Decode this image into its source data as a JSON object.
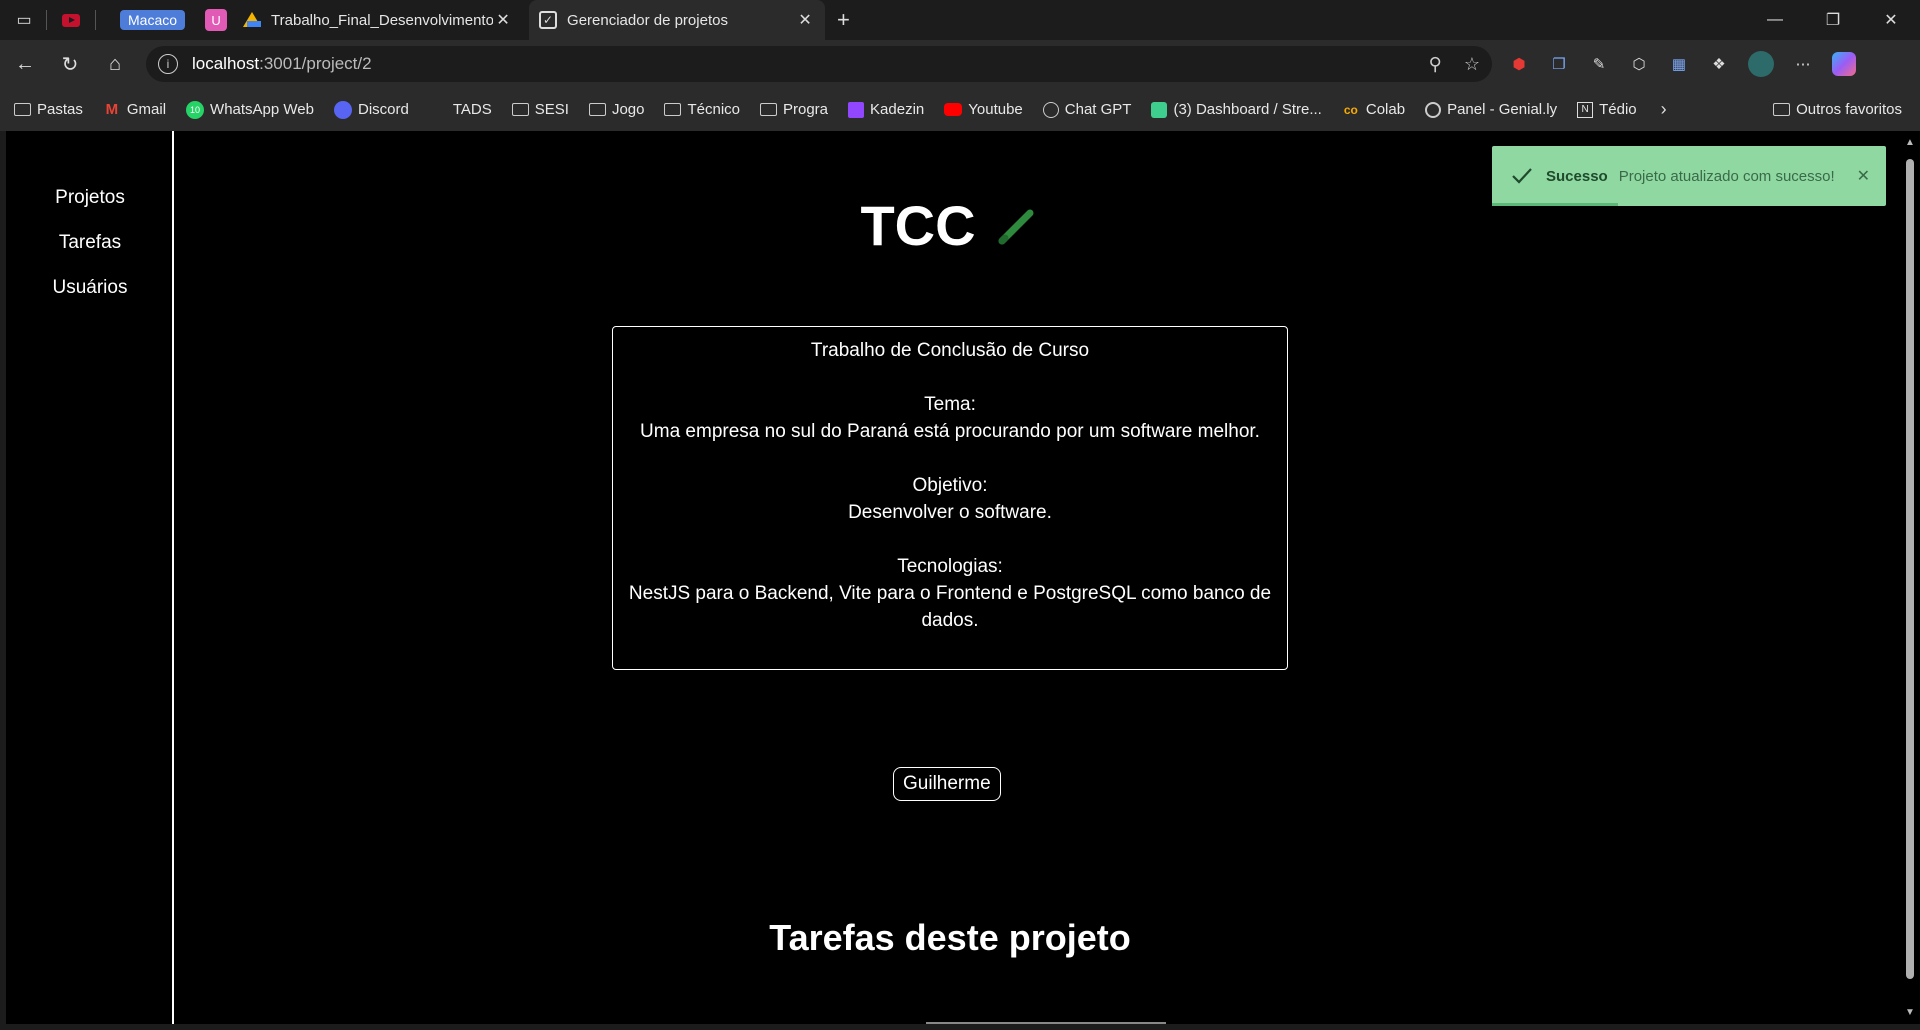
{
  "browser": {
    "group_label": "Macaco",
    "pinned_u": "U",
    "tabs": [
      {
        "title": "Trabalho_Final_Desenvolvimento_"
      },
      {
        "title": "Gerenciador de projetos"
      }
    ],
    "url_host": "localhost",
    "url_path": ":3001/project/2"
  },
  "bookmarks": {
    "items": [
      {
        "label": "Pastas",
        "icon": "folder-icon"
      },
      {
        "label": "Gmail",
        "icon": "gmail-icon"
      },
      {
        "label": "WhatsApp Web",
        "icon": "whatsapp-icon",
        "badge": "10"
      },
      {
        "label": "Discord",
        "icon": "discord-icon"
      },
      {
        "label": "TADS",
        "icon": "none"
      },
      {
        "label": "SESI",
        "icon": "folder-icon"
      },
      {
        "label": "Jogo",
        "icon": "folder-icon"
      },
      {
        "label": "Técnico",
        "icon": "folder-icon"
      },
      {
        "label": "Progra",
        "icon": "folder-icon"
      },
      {
        "label": "Kadezin",
        "icon": "twitch-icon"
      },
      {
        "label": "Youtube",
        "icon": "youtube-icon"
      },
      {
        "label": "Chat GPT",
        "icon": "chatgpt-icon"
      },
      {
        "label": "(3) Dashboard / Stre...",
        "icon": "dashboard-icon"
      },
      {
        "label": "Colab",
        "icon": "colab-icon"
      },
      {
        "label": "Panel - Genial.ly",
        "icon": "genially-icon"
      },
      {
        "label": "Tédio",
        "icon": "notion-icon"
      }
    ],
    "other_favorites": "Outros favoritos"
  },
  "app_nav": {
    "items": [
      {
        "label": "Projetos"
      },
      {
        "label": "Tarefas"
      },
      {
        "label": "Usuários"
      }
    ]
  },
  "project": {
    "title": "TCC",
    "description": "Trabalho de Conclusão de Curso\n\nTema:\nUma empresa no sul do Paraná está procurando por um software melhor.\n\nObjetivo:\nDesenvolver o software.\n\nTecnologias:\nNestJS para o Backend, Vite para o Frontend e PostgreSQL como banco de dados.",
    "member": "Guilherme",
    "tasks_heading": "Tarefas deste projeto"
  },
  "toast": {
    "summary": "Sucesso",
    "detail": "Projeto atualizado com sucesso!"
  },
  "colors": {
    "page_bg": "#000000",
    "chrome_bg": "#2b2b2b",
    "edit_icon": "#2e8b3e",
    "toast_bg": "#8fd8a2"
  }
}
